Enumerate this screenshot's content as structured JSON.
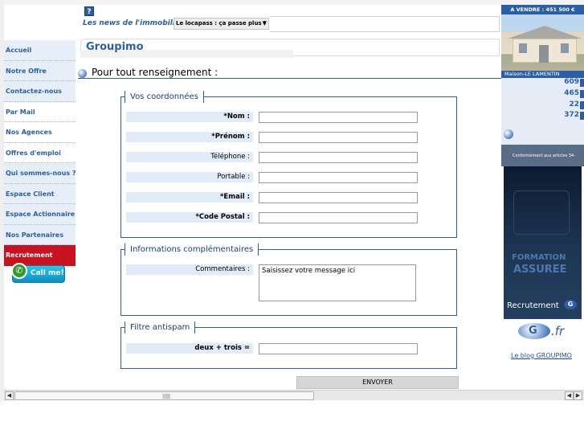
{
  "header": {
    "help_symbol": "?",
    "news_label": "Les news de l'immobilier :",
    "news_selected": "Le locapass : ça passe plus !",
    "news_arrow": "▼"
  },
  "nav": {
    "items": [
      {
        "label": "Accueil"
      },
      {
        "label": "Notre Offre"
      },
      {
        "label": "Contactez-nous"
      },
      {
        "label": "Par Mail"
      },
      {
        "label": "Nos Agences"
      },
      {
        "label": "Offres d'emploi"
      },
      {
        "label": "Qui sommes-nous ?"
      },
      {
        "label": "Espace Client"
      },
      {
        "label": "Espace Actionnaire"
      },
      {
        "label": "Nos Partenaires"
      },
      {
        "label": "Recrutement"
      }
    ],
    "call_label": "Call me!",
    "call_icon": "phone-icon"
  },
  "main": {
    "brand": "Groupimo",
    "section_title": "Pour tout renseignement :",
    "coords": {
      "legend": "Vos coordonnées",
      "fields": [
        {
          "label": "*Nom :",
          "value": ""
        },
        {
          "label": "*Prénom :",
          "value": ""
        },
        {
          "label": "Téléphone :",
          "value": ""
        },
        {
          "label": "Portable :",
          "value": ""
        },
        {
          "label": "*Email :",
          "value": ""
        },
        {
          "label": "*Code Postal :",
          "value": ""
        }
      ]
    },
    "info": {
      "legend": "Informations complémentaires",
      "comment_label": "Commentaires :",
      "comment_value": "Saisissez votre message ici"
    },
    "antispam": {
      "legend": "Filtre antispam",
      "question": "deux + trois =",
      "value": ""
    },
    "submit_label": "ENVOYER"
  },
  "right": {
    "sale_heading": "A VENDRE : 451 500 €",
    "caption": "Maison-LE LAMENTIN",
    "prices": [
      "609",
      "465",
      "22",
      "372"
    ],
    "small_print": "Conformément aux articles 34-",
    "ad_line1": "FORMATION",
    "ad_line2": "ASSUREE",
    "ad_line3": "Recrutement",
    "ad_badge": "G",
    "logo_letter": "G",
    "logo_suffix": ".fr",
    "blog_link": "Le blog GROUPIMO"
  },
  "scrollbar": {
    "left_arrow": "◀",
    "right_arrow_1": "◀",
    "right_arrow_2": "▶",
    "grip": "|||||||||"
  },
  "colors": {
    "brand_blue": "#2a5fa8",
    "active_red": "#c8121f",
    "label_bg": "#e2ecf8"
  }
}
